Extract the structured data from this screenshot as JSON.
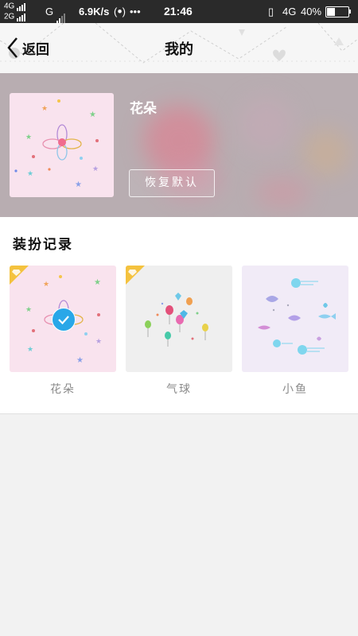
{
  "status_bar": {
    "net1": "4G",
    "net2": "2G",
    "net3": "G",
    "speed": "6.9K/s",
    "dots": "•••",
    "time": "21:46",
    "net4": "4G",
    "battery_pct": "40%"
  },
  "header": {
    "back_label": "返回",
    "title": "我的"
  },
  "current": {
    "name": "花朵",
    "restore_label": "恢复默认"
  },
  "records": {
    "title": "装扮记录",
    "items": [
      {
        "label": "花朵",
        "selected": true,
        "bg": "#f9e3ee",
        "vip": true
      },
      {
        "label": "气球",
        "selected": false,
        "bg": "#efefef",
        "vip": true
      },
      {
        "label": "小鱼",
        "selected": false,
        "bg": "#f1ebf7",
        "vip": false
      }
    ]
  },
  "colors": {
    "check_blue": "#2aa7e8",
    "badge_yellow": "#f4c23e",
    "hero_bg": "#b8adb1"
  }
}
